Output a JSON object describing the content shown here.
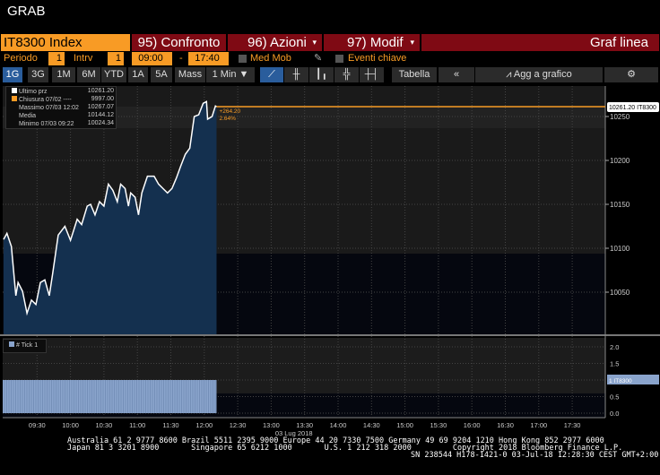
{
  "window_title": "GRAB",
  "toolbar1": {
    "ticker": "IT8300 Index",
    "compare": "95) Confronto",
    "actions": "96) Azioni",
    "modify": "97) Modif",
    "chart_type": "Graf linea"
  },
  "toolbar2": {
    "period_label": "Periodo",
    "period_value": "1",
    "interval_label": "Intrv",
    "interval_value": "1",
    "start_time": "09:00",
    "dash": "-",
    "end_time": "17:40",
    "moving_avg": "Med Mob",
    "key_events": "Eventi chiave"
  },
  "toolbar3": {
    "ranges": [
      "1G",
      "3G",
      "1M",
      "6M",
      "YTD",
      "1A",
      "5A",
      "Mass"
    ],
    "frequency": "1 Min ▼",
    "table": "Tabella",
    "collapse": "«",
    "add_to_chart": "Agg a grafico"
  },
  "legend": [
    {
      "label": "Ultimo prz",
      "value": "10261.20",
      "color": "#ffffff"
    },
    {
      "label": "Chiusura 07/02 ----",
      "value": "9997.00",
      "color": "#f89b25"
    },
    {
      "label": "Massimo 07/03 12:02",
      "value": "10267.07"
    },
    {
      "label": "Media",
      "value": "10144.12"
    },
    {
      "label": "Minimo 07/03 09:22",
      "value": "10024.34"
    }
  ],
  "change": {
    "abs": "+264.20",
    "pct": "2.64%"
  },
  "last_price_tag": "10261.20 IT8300",
  "volume_legend": "# Tick 1",
  "volume_tag": "1 IT8300",
  "date_label": "03 Lug 2018",
  "footer": {
    "line1": "Australia 61 2 9777 8600 Brazil 5511 2395 9000 Europe 44 20 7330 7500 Germany 49 69 9204 1210 Hong Kong 852 2977 6000",
    "line2": "Japan 81 3 3201 8900       Singapore 65 6212 1000       U.S. 1 212 318 2000         Copyright 2018 Bloomberg Finance L.P.",
    "line3": "SN 238544 H178-1421-0 03-Jul-18 12:28:30 CEST GMT+2:00"
  },
  "colors": {
    "accent": "#f89b25",
    "brand_red": "#7f0a14",
    "area": "#14304f",
    "line": "#ffffff"
  },
  "chart_data": {
    "type": "area",
    "title": "IT8300 Index",
    "xlabel": "03 Lug 2018",
    "ylabel": "",
    "x_ticks": [
      "09:30",
      "10:00",
      "10:30",
      "11:00",
      "11:30",
      "12:00",
      "12:30",
      "13:00",
      "13:30",
      "14:00",
      "14:30",
      "15:00",
      "15:30",
      "16:00",
      "16:30",
      "17:00",
      "17:30"
    ],
    "x_range": [
      "09:00",
      "17:40"
    ],
    "y_ticks": [
      10050,
      10100,
      10150,
      10200,
      10250
    ],
    "ylim": [
      10000,
      10275
    ],
    "reference_line": 10261.2,
    "x": [
      "09:00",
      "09:03",
      "09:07",
      "09:11",
      "09:13",
      "09:17",
      "09:21",
      "09:25",
      "09:29",
      "09:33",
      "09:37",
      "09:41",
      "09:44",
      "09:49",
      "09:55",
      "10:00",
      "10:06",
      "10:10",
      "10:15",
      "10:18",
      "10:22",
      "10:26",
      "10:30",
      "10:34",
      "10:38",
      "10:42",
      "10:45",
      "10:49",
      "10:52",
      "10:54",
      "10:58",
      "11:01",
      "11:04",
      "11:09",
      "11:15",
      "11:19",
      "11:23",
      "11:27",
      "11:31",
      "11:35",
      "11:39",
      "11:43",
      "11:47",
      "11:51",
      "11:55",
      "11:59",
      "12:02",
      "12:03",
      "12:07",
      "12:10",
      "12:11"
    ],
    "y": [
      10110,
      10117,
      10102,
      10046,
      10061,
      10051,
      10026,
      10041,
      10036,
      10061,
      10064,
      10046,
      10071,
      10115,
      10125,
      10109,
      10133,
      10127,
      10148,
      10150,
      10138,
      10153,
      10148,
      10173,
      10166,
      10153,
      10173,
      10168,
      10148,
      10163,
      10158,
      10138,
      10163,
      10182,
      10182,
      10173,
      10168,
      10163,
      10168,
      10180,
      10194,
      10207,
      10214,
      10250,
      10252,
      10265,
      10267,
      10247,
      10250,
      10262,
      10261.2
    ],
    "volume": {
      "name": "# Tick",
      "value": 1,
      "y_ticks": [
        0.0,
        0.5,
        1.0,
        1.5,
        2.0
      ],
      "ylim": [
        0,
        2.2
      ],
      "end": "12:11"
    }
  }
}
